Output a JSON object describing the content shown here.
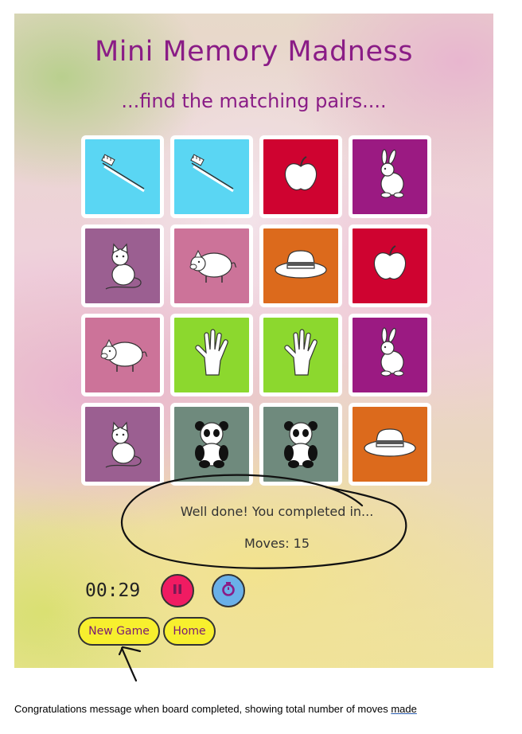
{
  "game": {
    "title": "Mini Memory Madness",
    "subtitle": "...find the matching pairs....",
    "cards": [
      {
        "icon": "toothbrush-icon",
        "color": "#5ad6f3"
      },
      {
        "icon": "toothbrush-icon",
        "color": "#5ad6f3"
      },
      {
        "icon": "apple-icon",
        "color": "#cf0330"
      },
      {
        "icon": "rabbit-icon",
        "color": "#9b1a82"
      },
      {
        "icon": "cat-icon",
        "color": "#9b5f91"
      },
      {
        "icon": "pig-icon",
        "color": "#cc7399"
      },
      {
        "icon": "hat-icon",
        "color": "#dc6a1c"
      },
      {
        "icon": "apple-icon",
        "color": "#cf0330"
      },
      {
        "icon": "pig-icon",
        "color": "#cc7399"
      },
      {
        "icon": "glove-icon",
        "color": "#8cd82e"
      },
      {
        "icon": "glove-icon",
        "color": "#8cd82e"
      },
      {
        "icon": "rabbit-icon",
        "color": "#9b1a82"
      },
      {
        "icon": "cat-icon",
        "color": "#9b5f91"
      },
      {
        "icon": "panda-icon",
        "color": "#6f8a7d"
      },
      {
        "icon": "panda-icon",
        "color": "#6f8a7d"
      },
      {
        "icon": "hat-icon",
        "color": "#dc6a1c"
      }
    ],
    "completion_message": "Well done! You completed in...",
    "moves_text": "Moves: 15",
    "timer": "00:29",
    "pause_button_icon": "pause-icon",
    "pause_button_color": "#f01b62",
    "stopwatch_button_icon": "stopwatch-icon",
    "stopwatch_button_color": "#6ab0e8",
    "new_game_label": "New Game",
    "home_label": "Home",
    "button_color": "#f7ef2e",
    "title_color": "#8a1c86"
  },
  "caption": {
    "text": "Congratulations message when board completed, showing total number of moves ",
    "underlined_word": "made"
  }
}
